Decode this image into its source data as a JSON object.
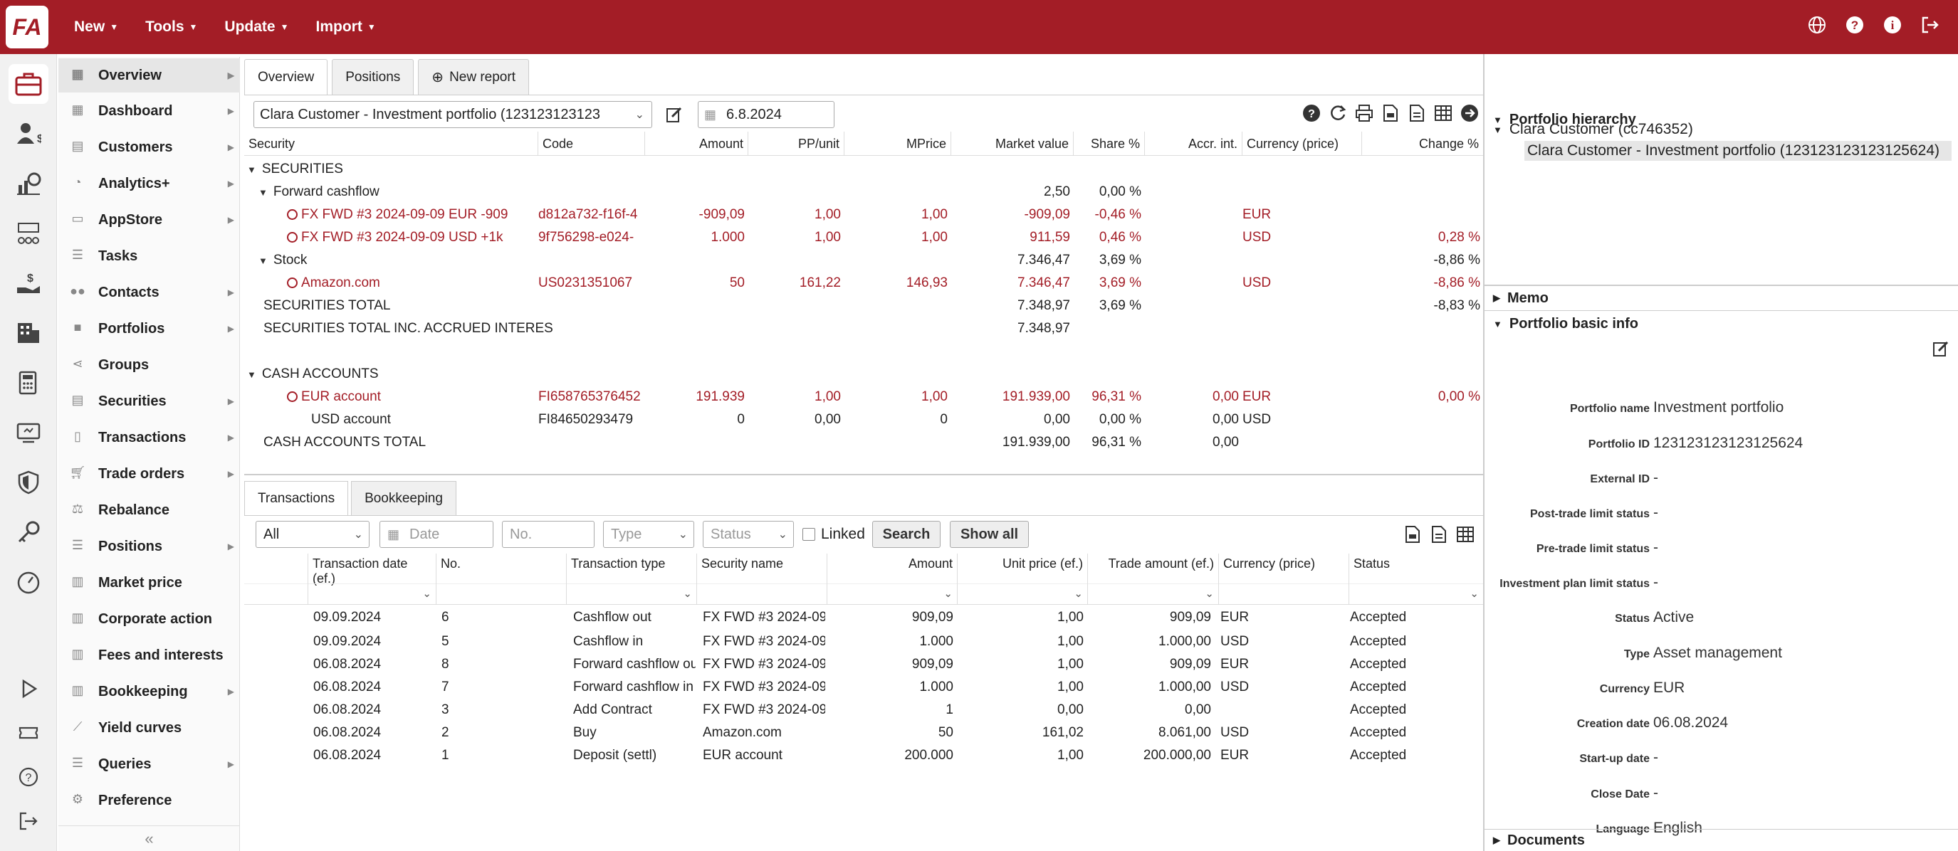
{
  "topbar": {
    "logo": "FA",
    "menu": [
      {
        "label": "New",
        "icon": "caret-down-icon"
      },
      {
        "label": "Tools",
        "icon": "caret-down-icon"
      },
      {
        "label": "Update",
        "icon": "caret-down-icon"
      },
      {
        "label": "Import",
        "icon": "caret-down-icon"
      }
    ],
    "icons": [
      "globe-icon",
      "help-icon",
      "info-icon",
      "logout-icon"
    ]
  },
  "iconrail": [
    "briefcase-icon",
    "user-money-icon",
    "analytics-icon",
    "network-icon",
    "hand-money-icon",
    "building-icon",
    "calculator-icon",
    "monitor-icon",
    "shield-icon",
    "key-icon",
    "gauge-icon",
    "play-icon",
    "ticket-icon",
    "help-circle-icon",
    "logout-icon"
  ],
  "sidenav": {
    "items": [
      {
        "label": "Overview",
        "icon": "table-icon",
        "arrow": true
      },
      {
        "label": "Dashboard",
        "icon": "dashboard-icon",
        "arrow": true
      },
      {
        "label": "Customers",
        "icon": "customers-icon",
        "arrow": true
      },
      {
        "label": "Analytics+",
        "icon": "analytics-icon",
        "arrow": true
      },
      {
        "label": "AppStore",
        "icon": "appstore-icon",
        "arrow": true
      },
      {
        "label": "Tasks",
        "icon": "tasks-icon",
        "arrow": false
      },
      {
        "label": "Contacts",
        "icon": "contacts-icon",
        "arrow": true
      },
      {
        "label": "Portfolios",
        "icon": "portfolios-icon",
        "arrow": true
      },
      {
        "label": "Groups",
        "icon": "groups-icon",
        "arrow": false
      },
      {
        "label": "Securities",
        "icon": "securities-icon",
        "arrow": true
      },
      {
        "label": "Transactions",
        "icon": "transactions-icon",
        "arrow": true
      },
      {
        "label": "Trade orders",
        "icon": "cart-icon",
        "arrow": true
      },
      {
        "label": "Rebalance",
        "icon": "scale-icon",
        "arrow": false
      },
      {
        "label": "Positions",
        "icon": "positions-icon",
        "arrow": true
      },
      {
        "label": "Market price",
        "icon": "market-price-icon",
        "arrow": false
      },
      {
        "label": "Corporate action",
        "icon": "corporate-action-icon",
        "arrow": false
      },
      {
        "label": "Fees and interests",
        "icon": "fees-icon",
        "arrow": false
      },
      {
        "label": "Bookkeeping",
        "icon": "bookkeeping-icon",
        "arrow": true
      },
      {
        "label": "Yield curves",
        "icon": "yield-curve-icon",
        "arrow": false
      },
      {
        "label": "Queries",
        "icon": "queries-icon",
        "arrow": true
      },
      {
        "label": "Preference",
        "icon": "gears-icon",
        "arrow": false
      }
    ],
    "collapse": "«"
  },
  "tabs": [
    "Overview",
    "Positions",
    "New report"
  ],
  "toolbar": {
    "portfolio": "Clara Customer - Investment portfolio  (123123123123",
    "date": "6.8.2024"
  },
  "positions": {
    "headers": [
      "Security",
      "Code",
      "Amount",
      "PP/unit",
      "MPrice",
      "Market value",
      "Share %",
      "Accr. int.",
      "Currency (price)",
      "Change %"
    ],
    "rows": [
      {
        "type": "group",
        "security": "SECURITIES"
      },
      {
        "type": "sub",
        "security": "Forward cashflow",
        "market_value": "2,50",
        "share": "0,00 %"
      },
      {
        "type": "item",
        "red": true,
        "security": "FX FWD #3 2024-09-09 EUR -909",
        "code": "d812a732-f16f-4",
        "amount": "-909,09",
        "pp": "1,00",
        "mprice": "1,00",
        "market_value": "-909,09",
        "share": "-0,46 %",
        "currency": "EUR"
      },
      {
        "type": "item",
        "red": true,
        "security": "FX FWD #3 2024-09-09 USD +1k",
        "code": "9f756298-e024-",
        "amount": "1.000",
        "pp": "1,00",
        "mprice": "1,00",
        "market_value": "911,59",
        "share": "0,46 %",
        "currency": "USD",
        "change": "0,28 %"
      },
      {
        "type": "sub",
        "security": "Stock",
        "market_value": "7.346,47",
        "share": "3,69 %",
        "change": "-8,86 %"
      },
      {
        "type": "item",
        "red": true,
        "security": "Amazon.com",
        "code": "US0231351067",
        "amount": "50",
        "pp": "161,22",
        "mprice": "146,93",
        "market_value": "7.346,47",
        "share": "3,69 %",
        "currency": "USD",
        "change": "-8,86 %"
      },
      {
        "type": "total",
        "security": "SECURITIES TOTAL",
        "market_value": "7.348,97",
        "share": "3,69 %",
        "change": "-8,83 %"
      },
      {
        "type": "total",
        "security": "SECURITIES TOTAL INC. ACCRUED INTERES",
        "market_value": "7.348,97"
      },
      {
        "type": "blank"
      },
      {
        "type": "group",
        "security": "CASH ACCOUNTS"
      },
      {
        "type": "item",
        "red": true,
        "security": "EUR account",
        "code": "FI658765376452",
        "amount": "191.939",
        "pp": "1,00",
        "mprice": "1,00",
        "market_value": "191.939,00",
        "share": "96,31 %",
        "accr": "0,00",
        "currency": "EUR",
        "change": "0,00 %"
      },
      {
        "type": "plain",
        "security": "USD account",
        "code": "FI84650293479",
        "amount": "0",
        "pp": "0,00",
        "mprice": "0",
        "market_value": "0,00",
        "share": "0,00 %",
        "accr": "0,00",
        "currency": "USD"
      },
      {
        "type": "total",
        "security": "CASH ACCOUNTS TOTAL",
        "market_value": "191.939,00",
        "share": "96,31 %",
        "accr": "0,00"
      }
    ]
  },
  "bottom": {
    "tabs": [
      "Transactions",
      "Bookkeeping"
    ],
    "filters": {
      "all": "All",
      "date": "Date",
      "no": "No.",
      "type": "Type",
      "status": "Status",
      "linked": "Linked",
      "search": "Search",
      "show_all": "Show all"
    },
    "headers": [
      "Transaction date (ef.)",
      "No.",
      "Transaction type",
      "Security name",
      "Amount",
      "Unit price (ef.)",
      "Trade amount (ef.)",
      "Currency (price)",
      "Status"
    ],
    "rows": [
      [
        "09.09.2024",
        "6",
        "Cashflow out",
        "FX FWD #3 2024-09",
        "909,09",
        "1,00",
        "909,09",
        "EUR",
        "Accepted"
      ],
      [
        "09.09.2024",
        "5",
        "Cashflow in",
        "FX FWD #3 2024-09",
        "1.000",
        "1,00",
        "1.000,00",
        "USD",
        "Accepted"
      ],
      [
        "06.08.2024",
        "8",
        "Forward cashflow ou",
        "FX FWD #3 2024-09",
        "909,09",
        "1,00",
        "909,09",
        "EUR",
        "Accepted"
      ],
      [
        "06.08.2024",
        "7",
        "Forward cashflow in",
        "FX FWD #3 2024-09",
        "1.000",
        "1,00",
        "1.000,00",
        "USD",
        "Accepted"
      ],
      [
        "06.08.2024",
        "3",
        "Add Contract",
        "FX FWD #3 2024-09",
        "1",
        "0,00",
        "0,00",
        "",
        "Accepted"
      ],
      [
        "06.08.2024",
        "2",
        "Buy",
        "Amazon.com",
        "50",
        "161,02",
        "8.061,00",
        "USD",
        "Accepted"
      ],
      [
        "06.08.2024",
        "1",
        "Deposit (settl)",
        "EUR account",
        "200.000",
        "1,00",
        "200.000,00",
        "EUR",
        "Accepted"
      ]
    ]
  },
  "right": {
    "hierarchy_title": "Portfolio hierarchy",
    "hierarchy_parent": "Clara Customer (cc746352)",
    "hierarchy_child": "Clara Customer - Investment portfolio (123123123123125624)",
    "memo": "Memo",
    "basic_info": "Portfolio basic info",
    "documents": "Documents",
    "fields": [
      {
        "label": "Portfolio name",
        "value": "Investment portfolio"
      },
      {
        "label": "Portfolio ID",
        "value": "123123123123125624"
      },
      {
        "label": "External ID",
        "value": "-"
      },
      {
        "label": "Post-trade limit status",
        "value": "-"
      },
      {
        "label": "Pre-trade limit status",
        "value": "-"
      },
      {
        "label": "Investment plan limit status",
        "value": "-"
      },
      {
        "label": "Status",
        "value": "Active"
      },
      {
        "label": "Type",
        "value": "Asset management"
      },
      {
        "label": "Currency",
        "value": "EUR"
      },
      {
        "label": "Creation date",
        "value": "06.08.2024"
      },
      {
        "label": "Start-up date",
        "value": "-"
      },
      {
        "label": "Close Date",
        "value": "-"
      },
      {
        "label": "Language",
        "value": "English"
      }
    ]
  }
}
